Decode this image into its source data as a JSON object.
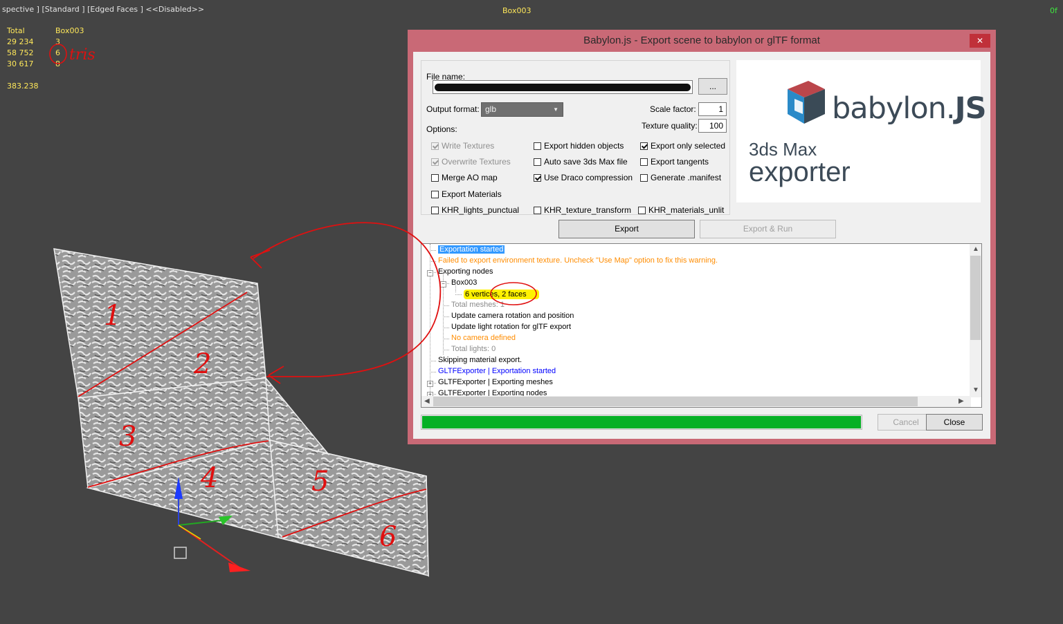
{
  "viewport": {
    "label": "spective ] [Standard ] [Edged Faces ]  <<Disabled>>",
    "object_name": "Box003",
    "frame": "0f"
  },
  "stats": {
    "header": [
      "Total",
      "Box003"
    ],
    "rows": [
      [
        "29 234",
        "3"
      ],
      [
        "58 752",
        "6"
      ],
      [
        "30 617",
        "8"
      ]
    ],
    "fps": "383.238"
  },
  "annotations": {
    "tris": "tris",
    "numbers": [
      "1",
      "2",
      "3",
      "4",
      "5",
      "6"
    ]
  },
  "dialog": {
    "title": "Babylon.js - Export scene to babylon or glTF format",
    "close_icon": "close-icon",
    "file_name_label": "File name:",
    "browse_label": "...",
    "output_format_label": "Output format:",
    "output_format_value": "glb",
    "scale_factor_label": "Scale factor:",
    "scale_factor_value": "1",
    "texture_quality_label": "Texture quality:",
    "texture_quality_value": "100",
    "options_label": "Options:",
    "options": [
      {
        "label": "Write Textures",
        "checked": true,
        "disabled": true
      },
      {
        "label": "Overwrite Textures",
        "checked": true,
        "disabled": true
      },
      {
        "label": "Merge AO map",
        "checked": false,
        "disabled": false
      },
      {
        "label": "Export Materials",
        "checked": false,
        "disabled": false
      },
      {
        "label": "KHR_lights_punctual",
        "checked": false,
        "disabled": false
      },
      {
        "label": "Export hidden objects",
        "checked": false,
        "disabled": false
      },
      {
        "label": "Auto save 3ds Max file",
        "checked": false,
        "disabled": false
      },
      {
        "label": "Use Draco compression",
        "checked": true,
        "disabled": false
      },
      {
        "label": "KHR_texture_transform",
        "checked": false,
        "disabled": false
      },
      {
        "label": "Export only selected",
        "checked": true,
        "disabled": false
      },
      {
        "label": "Export tangents",
        "checked": false,
        "disabled": false
      },
      {
        "label": "Generate .manifest",
        "checked": false,
        "disabled": false
      },
      {
        "label": "KHR_materials_unlit",
        "checked": false,
        "disabled": false
      }
    ],
    "logo": {
      "brand_a": "babylon.",
      "brand_b": "JS",
      "line1": "3ds Max",
      "line2": "exporter"
    },
    "export_button": "Export",
    "export_run_button": "Export & Run",
    "log": [
      {
        "text": "Exportation started",
        "color": "#ffffff",
        "bg": "#3399ff"
      },
      {
        "text": "Failed to export environment texture. Uncheck \"Use Map\" option to fix this warning.",
        "color": "#ff8c00"
      },
      {
        "text": "Exporting nodes",
        "color": "#000000"
      },
      {
        "text": "Box003",
        "color": "#000000"
      },
      {
        "text": "6 vertices, 2 faces",
        "color": "#000000",
        "bg": "#fff200"
      },
      {
        "text": "Total meshes: 1",
        "color": "#8a8a8a"
      },
      {
        "text": "Update camera rotation and position",
        "color": "#000000"
      },
      {
        "text": "Update light rotation for glTF export",
        "color": "#000000"
      },
      {
        "text": "No camera defined",
        "color": "#ff8c00"
      },
      {
        "text": "Total lights: 0",
        "color": "#8a8a8a"
      },
      {
        "text": "Skipping material export.",
        "color": "#000000"
      },
      {
        "text": "GLTFExporter | Exportation started",
        "color": "#0000ff"
      },
      {
        "text": "GLTFExporter | Exporting meshes",
        "color": "#000000"
      },
      {
        "text": "GLTFExporter | Exporting nodes",
        "color": "#000000"
      }
    ],
    "progress": 1.0,
    "cancel_button": "Cancel",
    "close_button": "Close"
  },
  "colors": {
    "dialog_frame": "#c96976",
    "progress": "#06b025",
    "annotation": "#e01010"
  }
}
